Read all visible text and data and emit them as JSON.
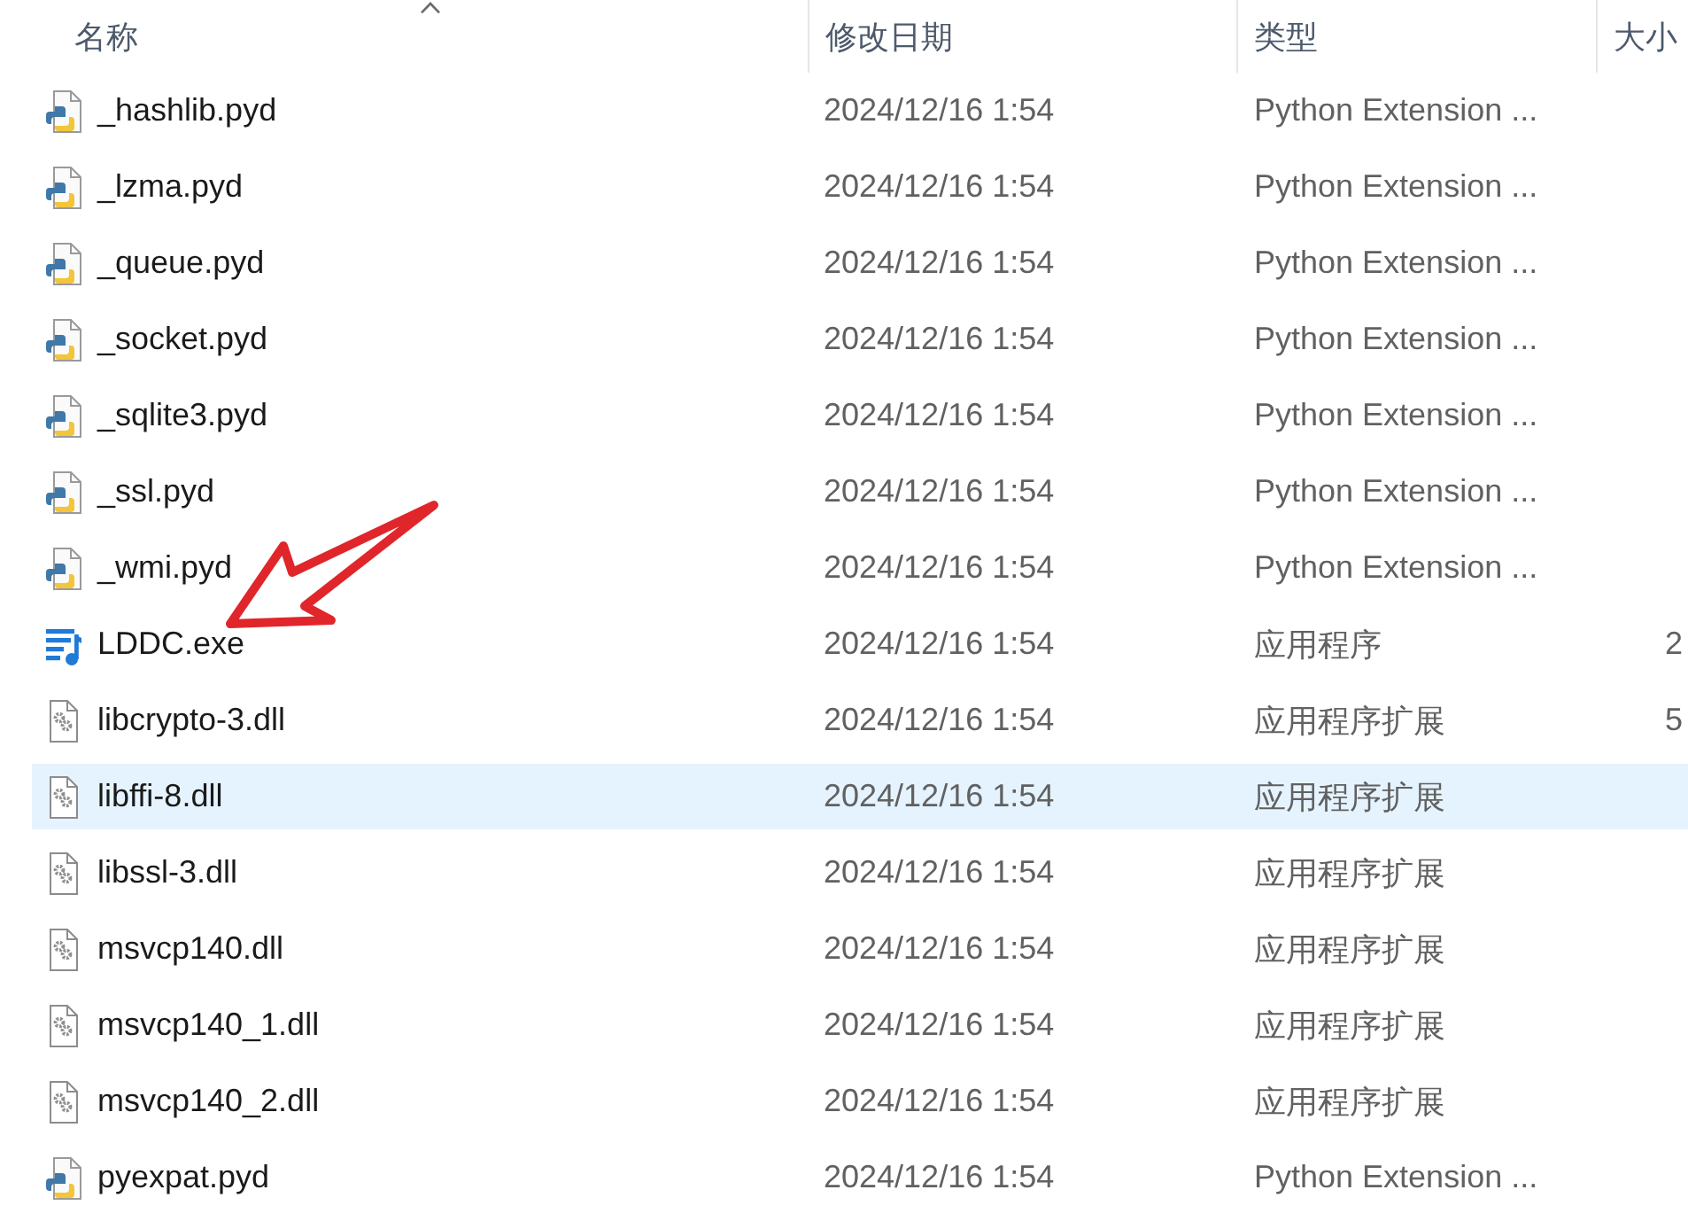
{
  "columns": [
    {
      "label": "名称",
      "sorted": true
    },
    {
      "label": "修改日期",
      "sorted": false
    },
    {
      "label": "类型",
      "sorted": false
    },
    {
      "label": "大小",
      "sorted": false
    }
  ],
  "rows": [
    {
      "name": "_hashlib.pyd",
      "kind": "python",
      "date": "2024/12/16 1:54",
      "type": "Python Extension ...",
      "selected": false,
      "marked": false
    },
    {
      "name": "_lzma.pyd",
      "kind": "python",
      "date": "2024/12/16 1:54",
      "type": "Python Extension ...",
      "selected": false,
      "marked": false
    },
    {
      "name": "_queue.pyd",
      "kind": "python",
      "date": "2024/12/16 1:54",
      "type": "Python Extension ...",
      "selected": false,
      "marked": false
    },
    {
      "name": "_socket.pyd",
      "kind": "python",
      "date": "2024/12/16 1:54",
      "type": "Python Extension ...",
      "selected": false,
      "marked": false
    },
    {
      "name": "_sqlite3.pyd",
      "kind": "python",
      "date": "2024/12/16 1:54",
      "type": "Python Extension ...",
      "selected": false,
      "marked": false
    },
    {
      "name": "_ssl.pyd",
      "kind": "python",
      "date": "2024/12/16 1:54",
      "type": "Python Extension ...",
      "selected": false,
      "marked": false
    },
    {
      "name": "_wmi.pyd",
      "kind": "python",
      "date": "2024/12/16 1:54",
      "type": "Python Extension ...",
      "selected": false,
      "marked": false
    },
    {
      "name": "LDDC.exe",
      "kind": "app",
      "date": "2024/12/16 1:54",
      "type": "应用程序",
      "size": "2",
      "selected": false,
      "marked": true
    },
    {
      "name": "libcrypto-3.dll",
      "kind": "library",
      "date": "2024/12/16 1:54",
      "type": "应用程序扩展",
      "size": "5",
      "selected": false,
      "marked": false
    },
    {
      "name": "libffi-8.dll",
      "kind": "library",
      "date": "2024/12/16 1:54",
      "type": "应用程序扩展",
      "selected": true,
      "marked": false
    },
    {
      "name": "libssl-3.dll",
      "kind": "library",
      "date": "2024/12/16 1:54",
      "type": "应用程序扩展",
      "selected": false,
      "marked": false
    },
    {
      "name": "msvcp140.dll",
      "kind": "library",
      "date": "2024/12/16 1:54",
      "type": "应用程序扩展",
      "selected": false,
      "marked": false
    },
    {
      "name": "msvcp140_1.dll",
      "kind": "library",
      "date": "2024/12/16 1:54",
      "type": "应用程序扩展",
      "selected": false,
      "marked": false
    },
    {
      "name": "msvcp140_2.dll",
      "kind": "library",
      "date": "2024/12/16 1:54",
      "type": "应用程序扩展",
      "selected": false,
      "marked": false
    },
    {
      "name": "pyexpat.pyd",
      "kind": "python",
      "date": "2024/12/16 1:54",
      "type": "Python Extension ...",
      "selected": false,
      "marked": false
    }
  ]
}
